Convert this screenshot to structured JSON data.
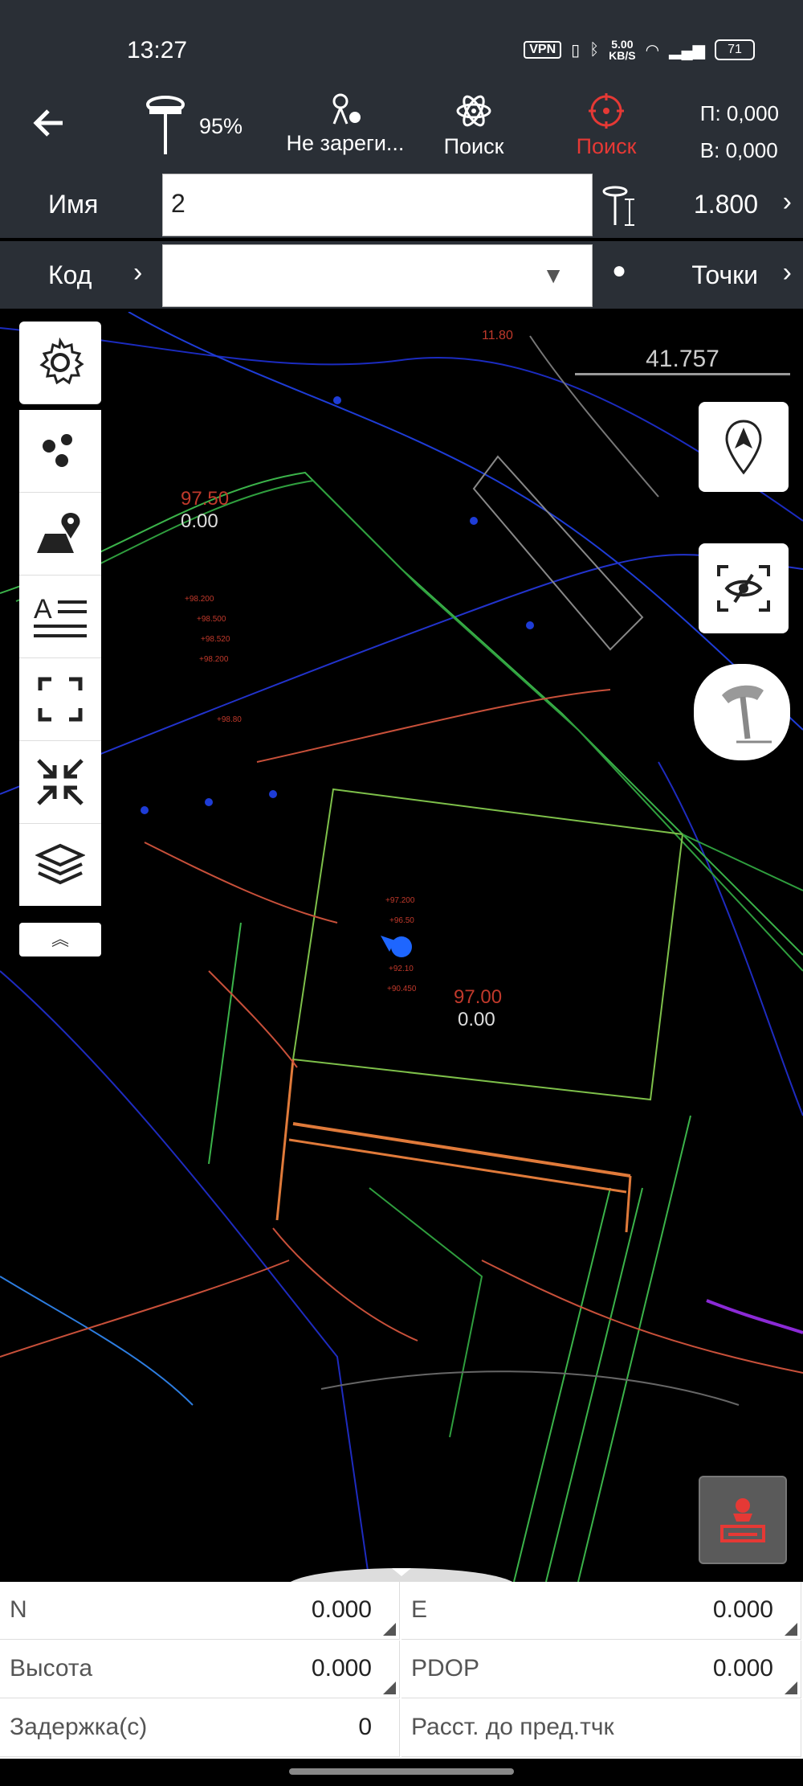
{
  "status_bar": {
    "time": "13:27",
    "vpn": "VPN",
    "speed_value": "5.00",
    "speed_unit": "KB/S",
    "battery": "71"
  },
  "toolbar": {
    "back_icon": "arrow-left-icon",
    "gps_percent": "95%",
    "register_label": "Не зареги...",
    "search_label": "Поиск",
    "search2_label": "Поиск",
    "p_value": "П: 0,000",
    "v_value": "В: 0,000",
    "accent_color": "#e53935"
  },
  "form": {
    "name_label": "Имя",
    "name_value": "2",
    "antenna_height": "1.800",
    "code_label": "Код",
    "code_value": "",
    "points_label": "Точки"
  },
  "map": {
    "scale_value": "41.757",
    "labels": [
      "97.50",
      "0.00",
      "97.00",
      "0.00",
      "11.80"
    ]
  },
  "bottom": {
    "cells": [
      {
        "label": "N",
        "value": "0.000"
      },
      {
        "label": "E",
        "value": "0.000"
      },
      {
        "label": "Высота",
        "value": "0.000"
      },
      {
        "label": "PDOP",
        "value": "0.000"
      },
      {
        "label": "Задержка(с)",
        "value": "0"
      },
      {
        "label": "Расст. до пред.тчк",
        "value": ""
      }
    ]
  }
}
